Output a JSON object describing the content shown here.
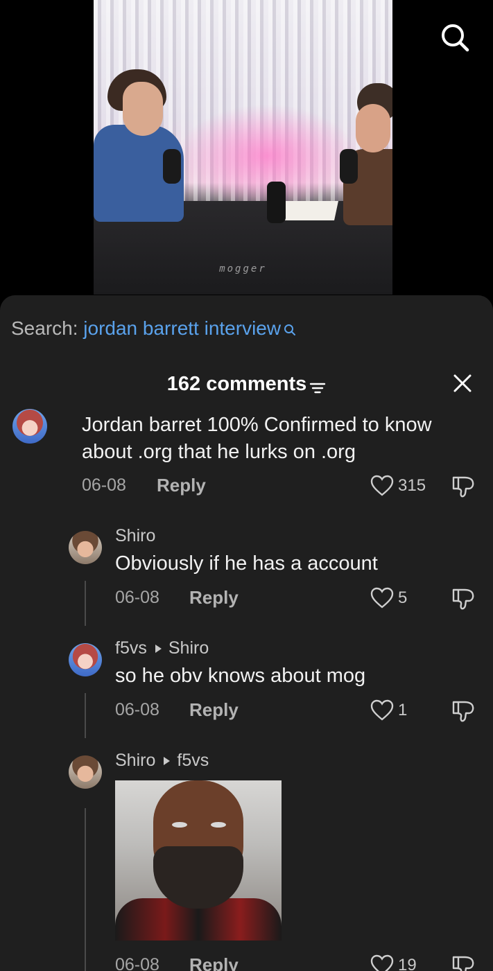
{
  "video": {
    "watermark": "mogger"
  },
  "search": {
    "label": "Search:",
    "query": "jordan barrett interview"
  },
  "header": {
    "comment_count": "162 comments"
  },
  "comments": [
    {
      "user": "",
      "text_line1": "Jordan barret 100% Confirmed to know",
      "text_line2": "about .org that he lurks on .org",
      "date": "06-08",
      "reply_label": "Reply",
      "likes": "315"
    },
    {
      "user": "Shiro",
      "reply_to": "",
      "text": "Obviously if he has a account",
      "date": "06-08",
      "reply_label": "Reply",
      "likes": "5"
    },
    {
      "user": "f5vs",
      "reply_to": "Shiro",
      "text": "so he obv knows about mog",
      "date": "06-08",
      "reply_label": "Reply",
      "likes": "1"
    },
    {
      "user": "Shiro",
      "reply_to": "f5vs",
      "text": "",
      "date": "06-08",
      "reply_label": "Reply",
      "likes": "19"
    }
  ],
  "colors": {
    "accent": "#5aa2ec",
    "sheet_bg": "#1f1f1f",
    "text": "#f2f2f2",
    "muted": "#a6a6a6"
  },
  "icons": [
    "search-icon",
    "filter-icon",
    "close-icon",
    "heart-icon",
    "dislike-icon",
    "search-suggest-icon"
  ]
}
